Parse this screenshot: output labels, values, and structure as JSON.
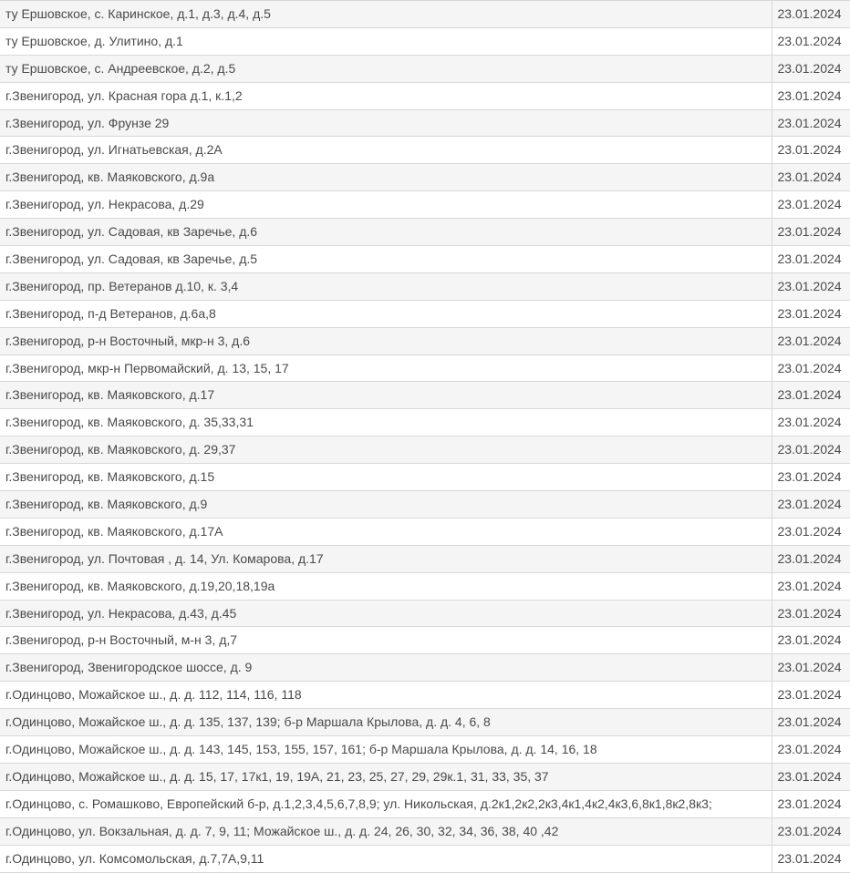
{
  "rows": [
    {
      "address": "ту Ершовское, с. Каринское, д.1, д.3, д.4, д.5",
      "date": "23.01.2024"
    },
    {
      "address": "ту Ершовское, д. Улитино, д.1",
      "date": "23.01.2024"
    },
    {
      "address": "ту Ершовское, с. Андреевское, д.2, д.5",
      "date": "23.01.2024"
    },
    {
      "address": "г.Звенигород, ул. Красная гора д.1, к.1,2",
      "date": "23.01.2024"
    },
    {
      "address": "г.Звенигород, ул. Фрунзе 29",
      "date": "23.01.2024"
    },
    {
      "address": "г.Звенигород, ул. Игнатьевская, д.2А",
      "date": "23.01.2024"
    },
    {
      "address": "г.Звенигород, кв. Маяковского, д.9а",
      "date": "23.01.2024"
    },
    {
      "address": "г.Звенигород, ул. Некрасова, д.29",
      "date": "23.01.2024"
    },
    {
      "address": "г.Звенигород, ул. Садовая, кв Заречье, д.6",
      "date": "23.01.2024"
    },
    {
      "address": "г.Звенигород, ул. Садовая, кв Заречье, д.5",
      "date": "23.01.2024"
    },
    {
      "address": "г.Звенигород, пр. Ветеранов д.10, к. 3,4",
      "date": "23.01.2024"
    },
    {
      "address": "г.Звенигород, п-д Ветеранов, д.6а,8",
      "date": "23.01.2024"
    },
    {
      "address": "г.Звенигород, р-н Восточный, мкр-н 3, д.6",
      "date": "23.01.2024"
    },
    {
      "address": "г.Звенигород, мкр-н Первомайский, д. 13, 15, 17",
      "date": "23.01.2024"
    },
    {
      "address": "г.Звенигород, кв. Маяковского, д.17",
      "date": "23.01.2024"
    },
    {
      "address": "г.Звенигород, кв. Маяковского, д. 35,33,31",
      "date": "23.01.2024"
    },
    {
      "address": "г.Звенигород, кв. Маяковского, д. 29,37",
      "date": "23.01.2024"
    },
    {
      "address": "г.Звенигород, кв. Маяковского, д.15",
      "date": "23.01.2024"
    },
    {
      "address": "г.Звенигород, кв. Маяковского, д.9",
      "date": "23.01.2024"
    },
    {
      "address": "г.Звенигород, кв. Маяковского, д.17А",
      "date": "23.01.2024"
    },
    {
      "address": "г.Звенигород, ул. Почтовая , д. 14, Ул. Комарова, д.17",
      "date": "23.01.2024"
    },
    {
      "address": "г.Звенигород, кв. Маяковского, д.19,20,18,19а",
      "date": "23.01.2024"
    },
    {
      "address": "г.Звенигород, ул. Некрасова, д.43, д.45",
      "date": "23.01.2024"
    },
    {
      "address": "г.Звенигород, р-н Восточный, м-н 3, д,7",
      "date": "23.01.2024"
    },
    {
      "address": "г.Звенигород, Звенигородское шоссе, д. 9",
      "date": "23.01.2024"
    },
    {
      "address": "г.Одинцово, Можайское ш., д. д. 112, 114, 116, 118",
      "date": "23.01.2024"
    },
    {
      "address": "г.Одинцово, Можайское ш., д. д. 135, 137, 139; б-р Маршала Крылова, д. д. 4, 6, 8",
      "date": "23.01.2024"
    },
    {
      "address": "г.Одинцово, Можайское ш., д. д. 143, 145, 153, 155, 157, 161; б-р Маршала Крылова, д. д. 14, 16, 18",
      "date": "23.01.2024"
    },
    {
      "address": "г.Одинцово, Можайское ш., д. д. 15, 17, 17к1, 19, 19А, 21, 23, 25, 27, 29, 29к.1, 31, 33, 35, 37",
      "date": "23.01.2024"
    },
    {
      "address": "г.Одинцово, с. Ромашково, Европейский б-р, д.1,2,3,4,5,6,7,8,9; ул. Никольская, д.2к1,2к2,2к3,4к1,4к2,4к3,6,8к1,8к2,8к3;",
      "date": "23.01.2024"
    },
    {
      "address": "г.Одинцово, ул. Вокзальная, д. д. 7, 9, 11; Можайское ш., д. д. 24, 26, 30, 32, 34, 36, 38, 40 ,42",
      "date": "23.01.2024"
    },
    {
      "address": "г.Одинцово, ул. Комсомольская, д.7,7А,9,11",
      "date": "23.01.2024"
    }
  ]
}
